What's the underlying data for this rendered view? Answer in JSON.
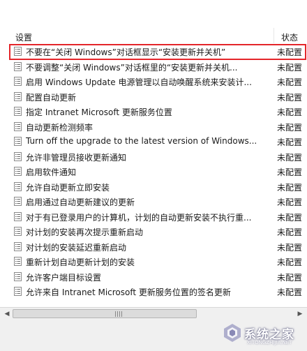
{
  "header": {
    "setting_col": "设置",
    "status_col": "状态"
  },
  "policies": [
    {
      "name": "不要在“关闭 Windows”对话框显示“安装更新并关机”",
      "status": "未配置"
    },
    {
      "name": "不要调整“关闭 Windows”对话框里的“安装更新并关机...",
      "status": "未配置"
    },
    {
      "name": "启用 Windows Update 电源管理以自动唤醒系统来安装计...",
      "status": "未配置"
    },
    {
      "name": "配置自动更新",
      "status": "未配置"
    },
    {
      "name": "指定 Intranet Microsoft 更新服务位置",
      "status": "未配置"
    },
    {
      "name": "自动更新检测频率",
      "status": "未配置"
    },
    {
      "name": "Turn off the upgrade to the latest version of Windows...",
      "status": "未配置"
    },
    {
      "name": "允许非管理员接收更新通知",
      "status": "未配置"
    },
    {
      "name": "启用软件通知",
      "status": "未配置"
    },
    {
      "name": "允许自动更新立即安装",
      "status": "未配置"
    },
    {
      "name": "启用通过自动更新建议的更新",
      "status": "未配置"
    },
    {
      "name": "对于有已登录用户的计算机，计划的自动更新安装不执行重...",
      "status": "未配置"
    },
    {
      "name": "对计划的安装再次提示重新启动",
      "status": "未配置"
    },
    {
      "name": "对计划的安装延迟重新启动",
      "status": "未配置"
    },
    {
      "name": "重新计划自动更新计划的安装",
      "status": "未配置"
    },
    {
      "name": "允许客户端目标设置",
      "status": "未配置"
    },
    {
      "name": "允许来自 Intranet Microsoft 更新服务位置的签名更新",
      "status": "未配置"
    }
  ],
  "selected_index": 0,
  "highlight_color": "#e4252a",
  "watermark": {
    "text": "系统之家",
    "sub": "XITONGZHIJIA.NET"
  }
}
